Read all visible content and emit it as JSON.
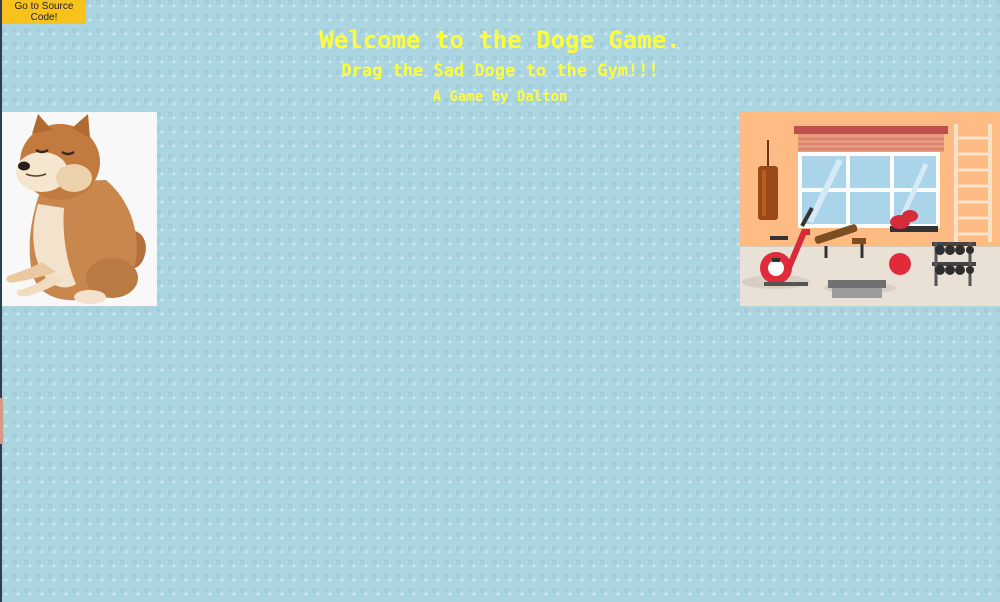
{
  "source_button": {
    "label": "Go to Source Code!"
  },
  "header": {
    "title": "Welcome to the Doge Game.",
    "subtitle": "Drag the Sad Doge to the Gym!!!",
    "byline": "A Game by Dalton"
  },
  "sprites": {
    "doge": "sad-doge-icon",
    "gym": "gym-icon"
  },
  "colors": {
    "background": "#abd6e1",
    "title_text": "#ffff3c",
    "button_bg": "#f6c21b",
    "gym_wall": "#ffbb83"
  }
}
